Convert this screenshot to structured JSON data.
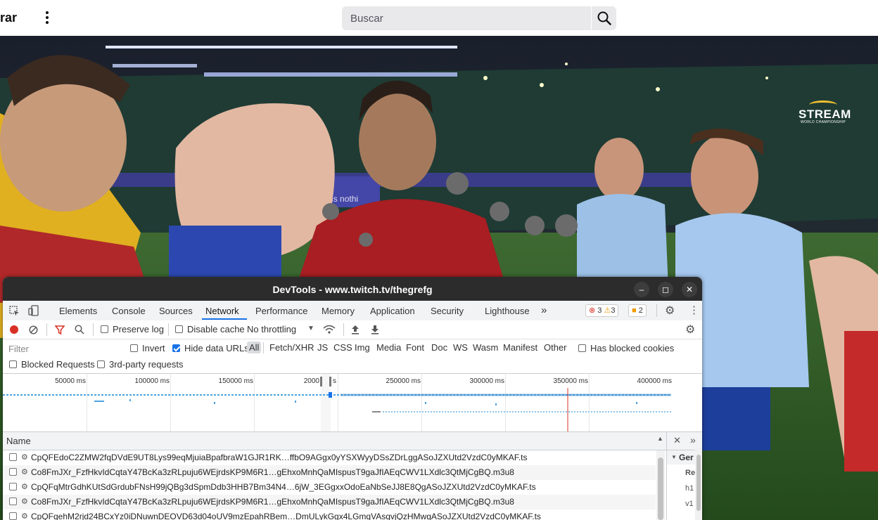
{
  "topbar": {
    "brand_text": "rar",
    "search_placeholder": "Buscar"
  },
  "video": {
    "logo_line1": "STREAM",
    "logo_line2": "WORLD CHAMPIONSHIP",
    "banner_text": "obla is nothi"
  },
  "devtools": {
    "title": "DevTools - www.twitch.tv/thegrefg",
    "tabs": [
      "Elements",
      "Console",
      "Sources",
      "Network",
      "Performance",
      "Memory",
      "Application",
      "Security",
      "Lighthouse"
    ],
    "active_tab": "Network",
    "more_tabs": "»",
    "badges": {
      "errors": "3",
      "warnings": "3",
      "issues": "2"
    },
    "toolbar": {
      "preserve_log": "Preserve log",
      "disable_cache": "Disable cache",
      "throttling": "No throttling"
    },
    "filter": {
      "placeholder": "Filter",
      "invert": "Invert",
      "hide_data_urls": "Hide data URLs",
      "types": [
        "All",
        "Fetch/XHR",
        "JS",
        "CSS",
        "Img",
        "Media",
        "Font",
        "Doc",
        "WS",
        "Wasm",
        "Manifest",
        "Other"
      ],
      "has_blocked_cookies": "Has blocked cookies",
      "blocked_requests": "Blocked Requests",
      "third_party": "3rd-party requests"
    },
    "overview_ticks": [
      "50000 ms",
      "100000 ms",
      "150000 ms",
      "2000",
      "s",
      "250000 ms",
      "300000 ms",
      "350000 ms",
      "400000 ms"
    ],
    "table": {
      "name_header": "Name",
      "rows": [
        "CpQFEdoC2ZMW2fqDVdE9UT8Lys99eqMjuiaBpafbraW1GJR1RK…ffbO9AGgx0yYSXWyyDSsZDrLggASoJZXUtd2VzdC0yMKAF.ts",
        "Co8FmJXr_FzfHkvIdCqtaY47BcKa3zRLpuju6WEjrdsKP9M6R1…gEhxoMnhQaMIspusT9gaJfIAEqCWV1LXdlc3QtMjCgBQ.m3u8",
        "CpQFqMtrGdhKUtSdGrdubFNsH99jQBg3dSpmDdb3HHB7Bm34N4…6jW_3EGgxxOdoEaNbSeJJ8E8QgASoJZXUtd2VzdC0yMKAF.ts",
        "Co8FmJXr_FzfHkvIdCqtaY47BcKa3zRLpuju6WEjrdsKP9M6R1…gEhxoMnhQaMIspusT9gaJfIAEqCWV1LXdlc3QtMjCgBQ.m3u8",
        "CpQFqehM2rjd24BCxYz0iDNuwnDEOVD63d04oUV9mzEpahRBem…DmULykGgx4LGmqVAsqvjQzHMwgASoJZXUtd2VzdC0yMKAF.ts"
      ]
    },
    "side_panel": {
      "header": "Ger",
      "lines": [
        "Re",
        "h1",
        "v1"
      ]
    }
  }
}
